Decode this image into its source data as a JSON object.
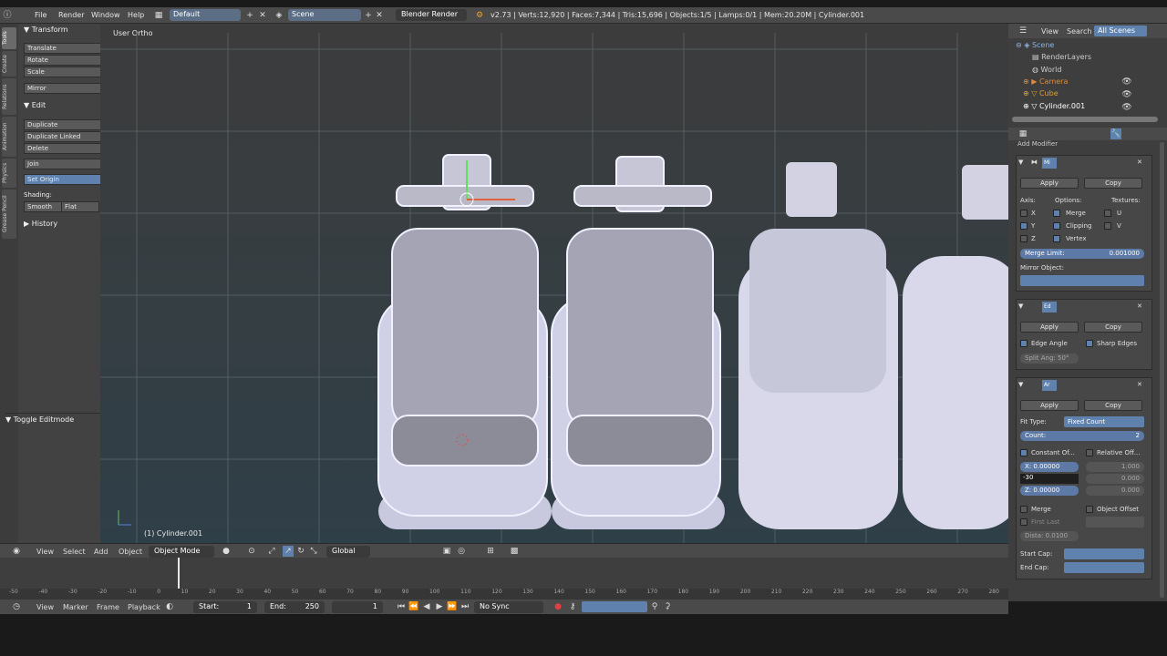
{
  "header": {
    "menus": [
      "File",
      "Render",
      "Window",
      "Help"
    ],
    "layout": "Default",
    "scene": "Scene",
    "engine": "Blender Render",
    "stats": "v2.73 | Verts:12,920 | Faces:7,344 | Tris:15,696 | Objects:1/5 | Lamps:0/1 | Mem:20.20M | Cylinder.001"
  },
  "tabs": [
    "Tools",
    "Create",
    "Relations",
    "Animation",
    "Physics",
    "Grease Pencil"
  ],
  "shelf": {
    "transform_title": "Transform",
    "translate": "Translate",
    "rotate": "Rotate",
    "scale": "Scale",
    "mirror": "Mirror",
    "edit_title": "Edit",
    "duplicate": "Duplicate",
    "duplicate_linked": "Duplicate Linked",
    "delete": "Delete",
    "join": "Join",
    "set_origin": "Set Origin",
    "shading_label": "Shading:",
    "smooth": "Smooth",
    "flat": "Flat",
    "history": "History",
    "toggle_editmode": "Toggle Editmode"
  },
  "viewport": {
    "view_label": "User Ortho",
    "object_label": "(1) Cylinder.001"
  },
  "viewport_header": {
    "view": "View",
    "select": "Select",
    "add": "Add",
    "object": "Object",
    "mode": "Object Mode",
    "orientation": "Global"
  },
  "timeline": {
    "ticks": [
      "-50",
      "-40",
      "-30",
      "-20",
      "-10",
      "0",
      "10",
      "20",
      "30",
      "40",
      "50",
      "60",
      "70",
      "80",
      "90",
      "100",
      "110",
      "120",
      "130",
      "140",
      "150",
      "160",
      "170",
      "180",
      "190",
      "200",
      "210",
      "220",
      "230",
      "240",
      "250",
      "260",
      "270",
      "280"
    ]
  },
  "timeline_header": {
    "view": "View",
    "marker": "Marker",
    "frame": "Frame",
    "playback": "Playback",
    "start_label": "Start:",
    "start_value": "1",
    "end_label": "End:",
    "end_value": "250",
    "current": "1",
    "sync": "No Sync"
  },
  "outliner": {
    "view": "View",
    "search": "Search",
    "all_scenes": "All Scenes",
    "items": [
      "Scene",
      "RenderLayers",
      "World",
      "Camera",
      "Cube",
      "Cylinder.001"
    ]
  },
  "props": {
    "add_modifier": "Add Modifier",
    "mirror": {
      "name": "Mi",
      "apply": "Apply",
      "copy": "Copy",
      "axis_label": "Axis:",
      "options_label": "Options:",
      "textures_label": "Textures:",
      "x": "X",
      "y": "Y",
      "z": "Z",
      "merge": "Merge",
      "clipping": "Clipping",
      "vertex": "Vertex",
      "u": "U",
      "v": "V",
      "merge_limit_label": "Merge Limit:",
      "merge_limit_value": "0.001000",
      "mirror_object_label": "Mirror Object:"
    },
    "edgesplit": {
      "name": "Ed",
      "apply": "Apply",
      "copy": "Copy",
      "edge_angle": "Edge Angle",
      "sharp_edges": "Sharp Edges",
      "split_angle": "Split Ang: 50°"
    },
    "array": {
      "name": "Ar",
      "apply": "Apply",
      "copy": "Copy",
      "fit_type_label": "Fit Type:",
      "fit_type_value": "Fixed Count",
      "count_label": "Count:",
      "count_value": "2",
      "constant_offset": "Constant Of...",
      "relative_offset": "Relative Off...",
      "x_label": "X:",
      "x_value": "0.00000",
      "y_typed": "-30",
      "z_label": "Z:",
      "z_value": "0.00000",
      "rel_x": "1.000",
      "rel_y": "0.000",
      "rel_z": "0.000",
      "merge": "Merge",
      "object_offset": "Object Offset",
      "first_last": "First Last",
      "distance": "Dista: 0.0100",
      "start_cap": "Start Cap:",
      "end_cap": "End Cap:"
    }
  }
}
